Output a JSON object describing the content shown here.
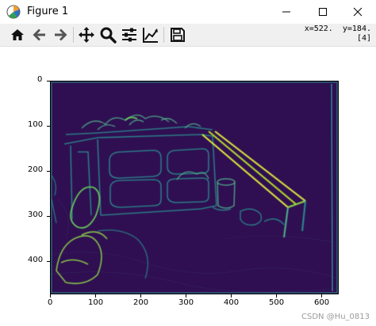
{
  "window": {
    "title": "Figure 1",
    "app_icon": "matplotlib-icon",
    "controls": [
      "minimize-icon",
      "maximize-icon",
      "close-icon"
    ]
  },
  "toolbar": {
    "buttons": [
      {
        "name": "home-button",
        "icon": "home-icon"
      },
      {
        "name": "back-button",
        "icon": "arrow-left-icon"
      },
      {
        "name": "forward-button",
        "icon": "arrow-right-icon"
      },
      {
        "name": "pan-button",
        "icon": "move-icon"
      },
      {
        "name": "zoom-button",
        "icon": "magnifier-icon"
      },
      {
        "name": "configure-subplots-button",
        "icon": "sliders-icon"
      },
      {
        "name": "edit-axis-button",
        "icon": "line-chart-icon"
      },
      {
        "name": "save-button",
        "icon": "save-icon"
      }
    ],
    "coordinate_readout": {
      "line1": "x=522.  y=184.",
      "line2": "[4]"
    }
  },
  "axes": {
    "x_ticks": [
      "0",
      "100",
      "200",
      "300",
      "400",
      "500",
      "600"
    ],
    "y_ticks": [
      "0",
      "100",
      "200",
      "300",
      "400"
    ]
  },
  "image": {
    "description_colormap": "viridis",
    "background_color": "#2f0f52",
    "edge_color_light": "#6ad25a",
    "edge_color_mid": "#2c8e8e",
    "edge_color_bright": "#e0ec3a"
  },
  "watermark": "CSDN @Hu_0813"
}
